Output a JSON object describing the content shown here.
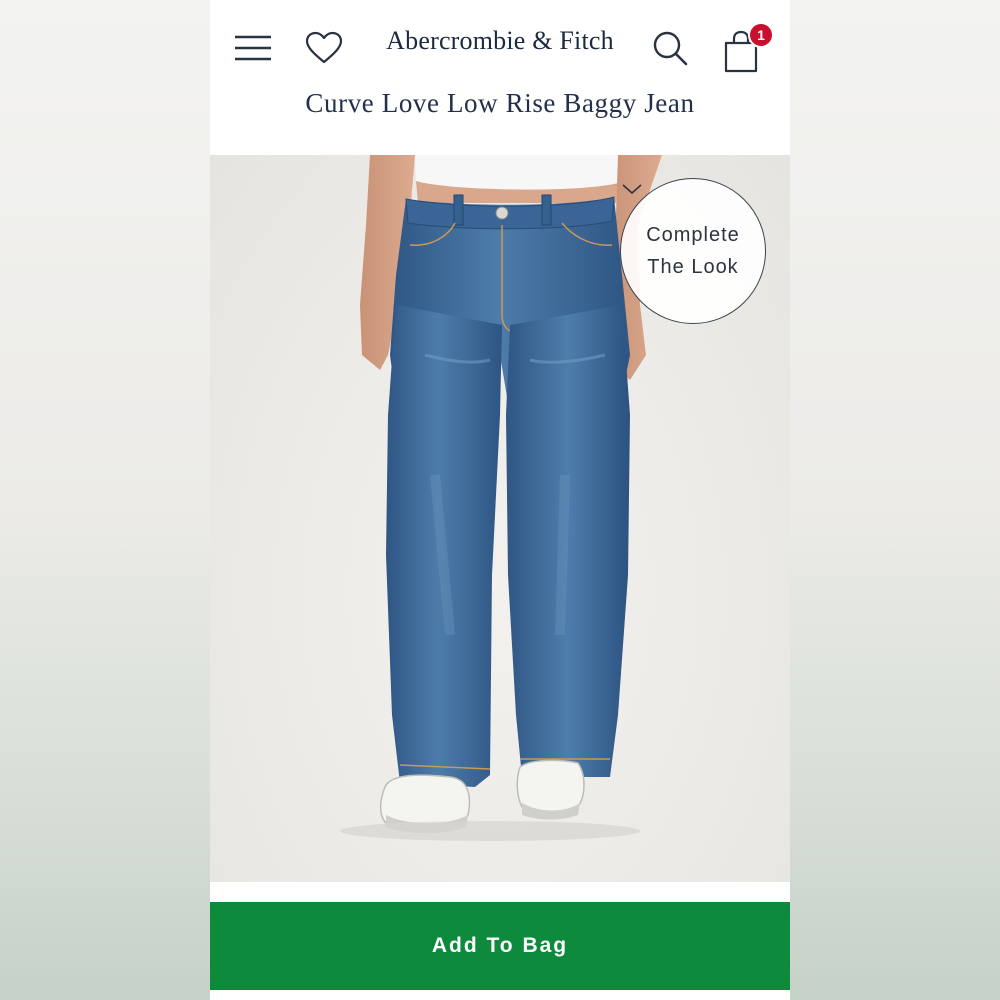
{
  "header": {
    "brand": "Abercrombie & Fitch",
    "product_title": "Curve Love Low Rise Baggy Jean",
    "menu_icon": "hamburger-menu-icon",
    "favorites_icon": "heart-icon",
    "search_icon": "search-icon",
    "bag_icon": "shopping-bag-icon",
    "bag_count": "1",
    "badge_color": "#c8102e"
  },
  "product": {
    "complete_look_line1": "Complete",
    "complete_look_line2": "The Look",
    "complete_look_icon": "chevron-down-icon"
  },
  "actions": {
    "add_to_bag_label": "Add To Bag",
    "add_to_bag_color": "#0e8a3c"
  },
  "colors": {
    "text_navy": "#1c2a3f",
    "denim": "#3f6a99"
  }
}
